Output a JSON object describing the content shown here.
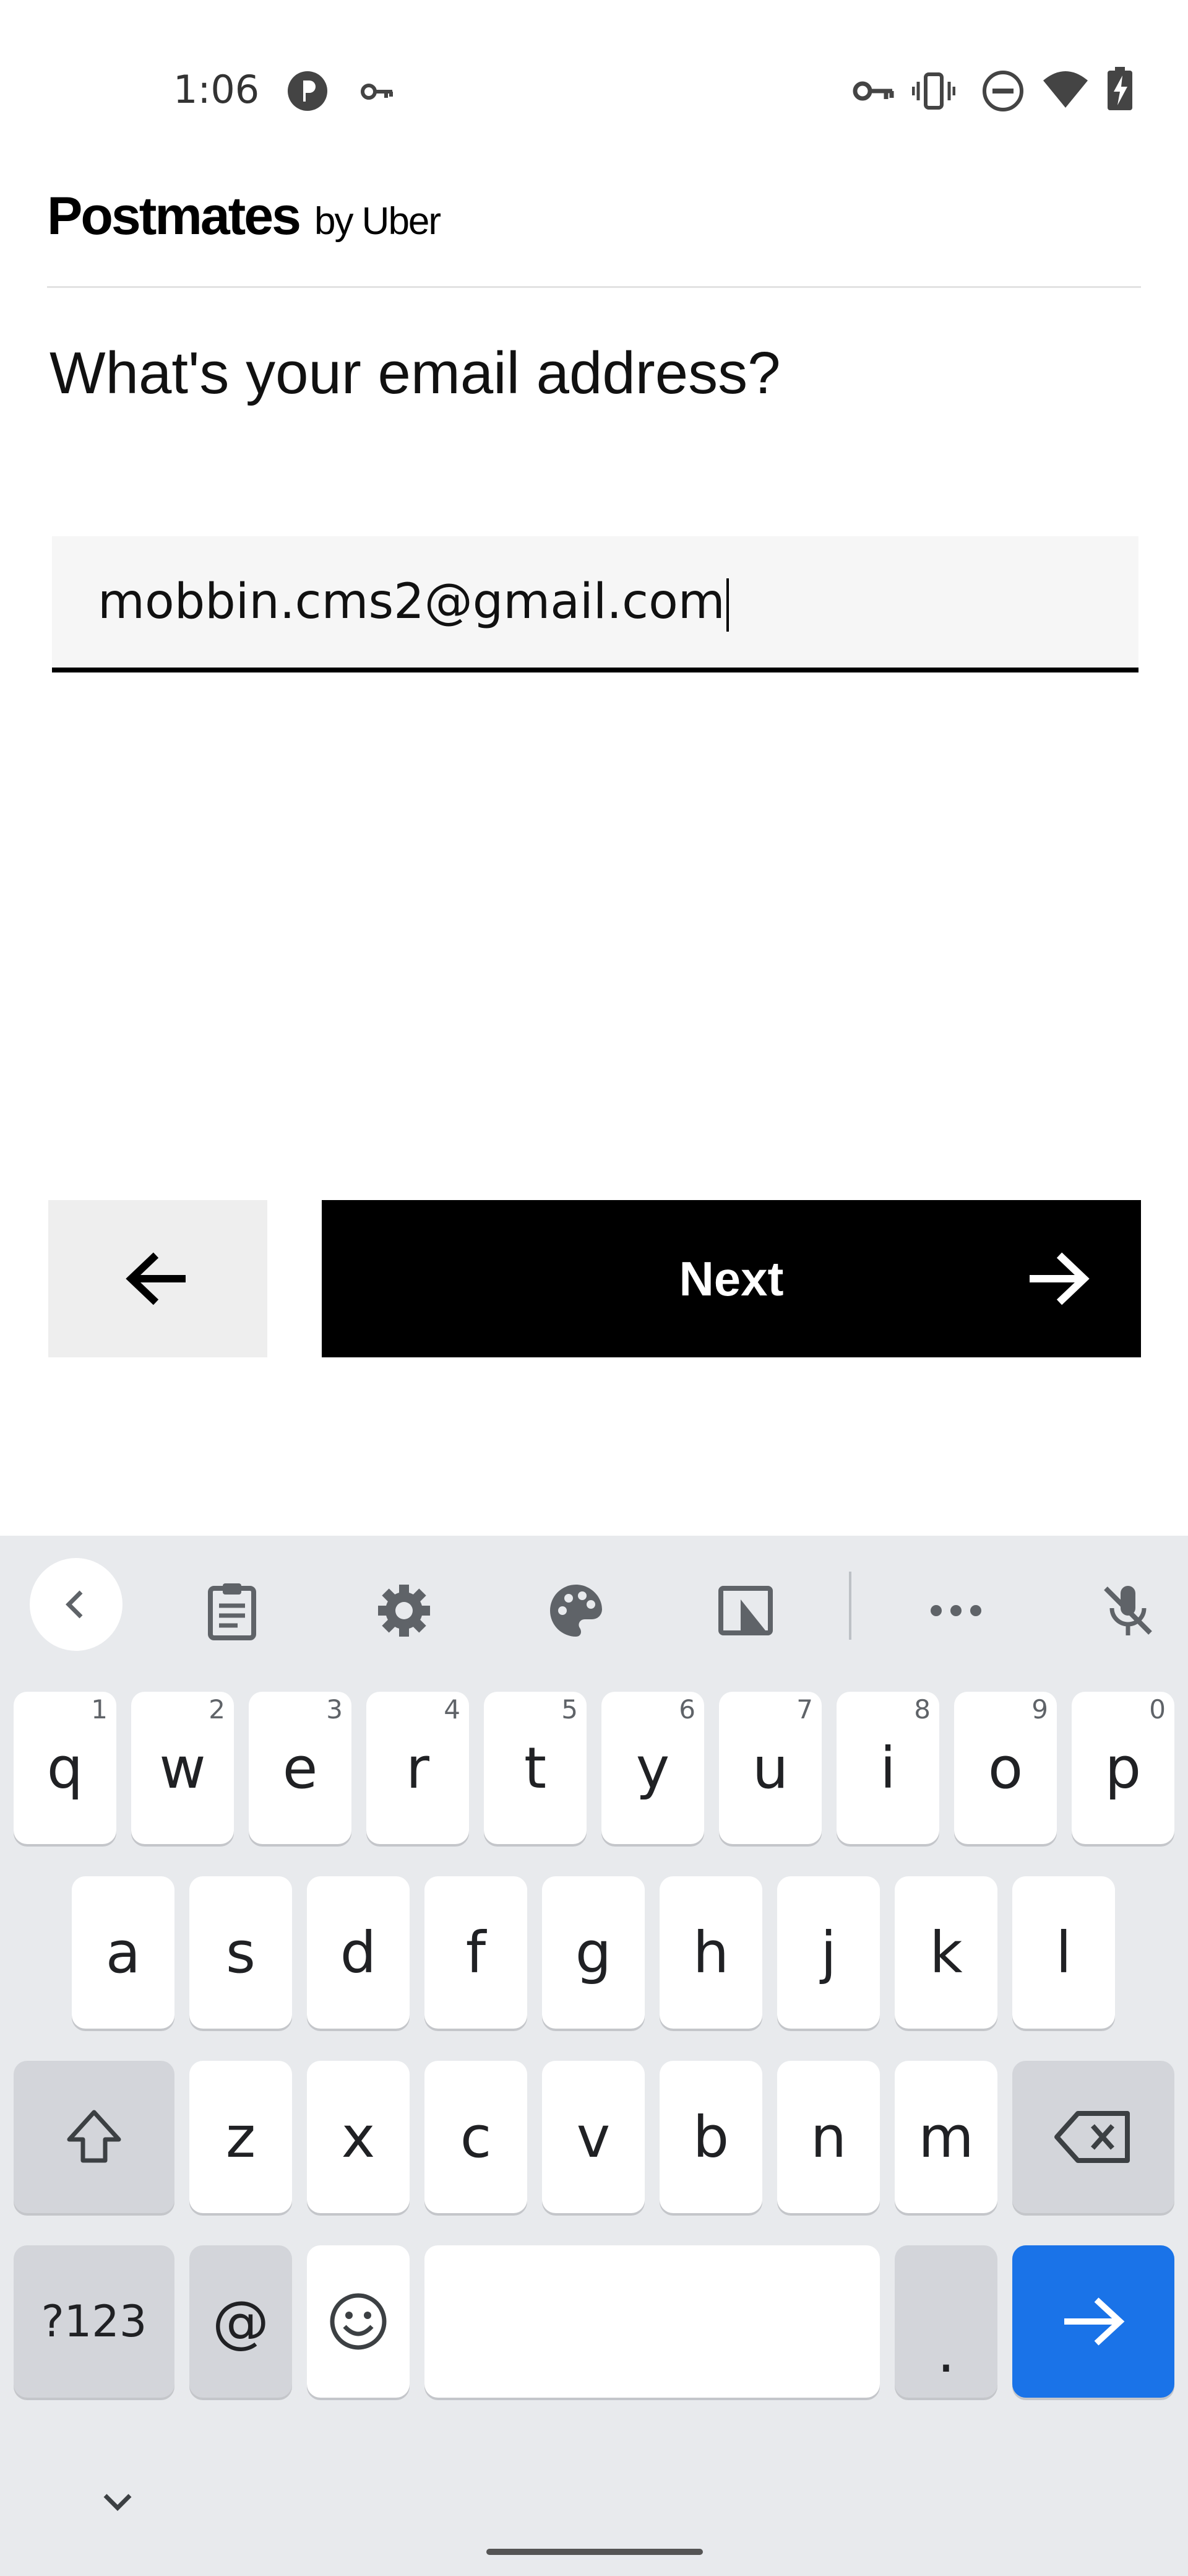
{
  "status_bar": {
    "time": "1:06",
    "left_icons": [
      "app-badge-icon",
      "key-icon"
    ],
    "right_icons": [
      "vpn-key-icon",
      "vibrate-icon",
      "do-not-disturb-icon",
      "wifi-icon",
      "battery-charging-icon"
    ]
  },
  "header": {
    "brand_main": "Postmates",
    "brand_by": "by Uber"
  },
  "form": {
    "question": "What's your email address?",
    "email_value": "mobbin.cms2@gmail.com"
  },
  "buttons": {
    "back_icon": "arrow-left-icon",
    "next_label": "Next",
    "next_icon": "arrow-right-icon"
  },
  "keyboard": {
    "toolbar": [
      "chevron-left-icon",
      "clipboard-icon",
      "settings-icon",
      "palette-icon",
      "floating-keyboard-icon",
      "more-icon",
      "mic-off-icon"
    ],
    "row1": [
      {
        "key": "q",
        "hint": "1"
      },
      {
        "key": "w",
        "hint": "2"
      },
      {
        "key": "e",
        "hint": "3"
      },
      {
        "key": "r",
        "hint": "4"
      },
      {
        "key": "t",
        "hint": "5"
      },
      {
        "key": "y",
        "hint": "6"
      },
      {
        "key": "u",
        "hint": "7"
      },
      {
        "key": "i",
        "hint": "8"
      },
      {
        "key": "o",
        "hint": "9"
      },
      {
        "key": "p",
        "hint": "0"
      }
    ],
    "row2": [
      "a",
      "s",
      "d",
      "f",
      "g",
      "h",
      "j",
      "k",
      "l"
    ],
    "row3": [
      "z",
      "x",
      "c",
      "v",
      "b",
      "n",
      "m"
    ],
    "symbols_label": "?123",
    "at_label": "@",
    "period_label": ".",
    "accent_color": "#1a73e8"
  }
}
